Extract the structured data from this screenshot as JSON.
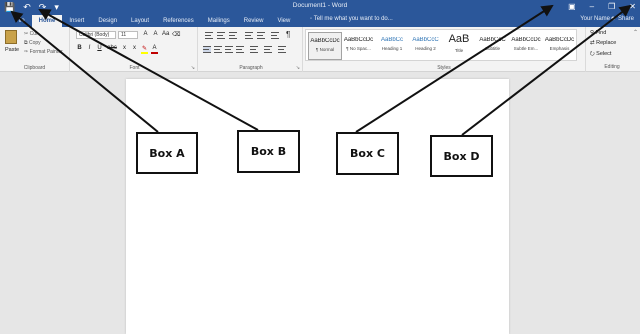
{
  "titlebar": {
    "quick_access": {
      "save_icon": "save-icon",
      "undo_icon": "undo-icon",
      "redo_icon": "redo-icon",
      "customize_icon": "customize-icon"
    },
    "document_title": "Document1 - Word",
    "window_buttons": {
      "ribbon_options": "ribbon-display-icon",
      "minimize": "minimize-icon",
      "restore": "restore-icon",
      "close": "close-icon"
    }
  },
  "tabs": [
    {
      "label": "File",
      "active": false
    },
    {
      "label": "Home",
      "active": true
    },
    {
      "label": "Insert",
      "active": false
    },
    {
      "label": "Design",
      "active": false
    },
    {
      "label": "Layout",
      "active": false
    },
    {
      "label": "References",
      "active": false
    },
    {
      "label": "Mailings",
      "active": false
    },
    {
      "label": "Review",
      "active": false
    },
    {
      "label": "View",
      "active": false
    }
  ],
  "tell_me": "Tell me what you want to do...",
  "user_name": "Your Name",
  "share_label": "Share",
  "ribbon": {
    "clipboard": {
      "label": "Clipboard",
      "paste": "Paste",
      "cut": "Cut",
      "copy": "Copy",
      "format_painter": "Format Painter"
    },
    "font": {
      "label": "Font",
      "font_name": "Calibri (Body)",
      "font_size": "11",
      "grow": "A",
      "shrink": "A",
      "case": "Aa",
      "bold": "B",
      "italic": "I",
      "underline": "U",
      "strike": "abc",
      "subscript": "x",
      "superscript": "x",
      "color": "A"
    },
    "paragraph": {
      "label": "Paragraph",
      "pilcrow": "¶"
    },
    "styles": {
      "label": "Styles",
      "items": [
        {
          "sample": "AaBbCcDc",
          "name": "¶ Normal"
        },
        {
          "sample": "AaBbCcDc",
          "name": "¶ No Spac..."
        },
        {
          "sample": "AaBbCc",
          "name": "Heading 1"
        },
        {
          "sample": "AaBbCcC",
          "name": "Heading 2"
        },
        {
          "sample": "AaB",
          "name": "Title"
        },
        {
          "sample": "AaBbCcC",
          "name": "Subtitle"
        },
        {
          "sample": "AaBbCcDc",
          "name": "Subtle Em..."
        },
        {
          "sample": "AaBbCcDc",
          "name": "Emphasis"
        }
      ]
    },
    "editing": {
      "label": "Editing",
      "find": "Find",
      "replace": "Replace",
      "select": "Select"
    }
  },
  "annotations": {
    "box_a": "Box A",
    "box_b": "Box B",
    "box_c": "Box C",
    "box_d": "Box D"
  },
  "colors": {
    "title_bar": "#2b579a",
    "ribbon": "#f3f3f3",
    "workspace": "#e6e6e6"
  }
}
